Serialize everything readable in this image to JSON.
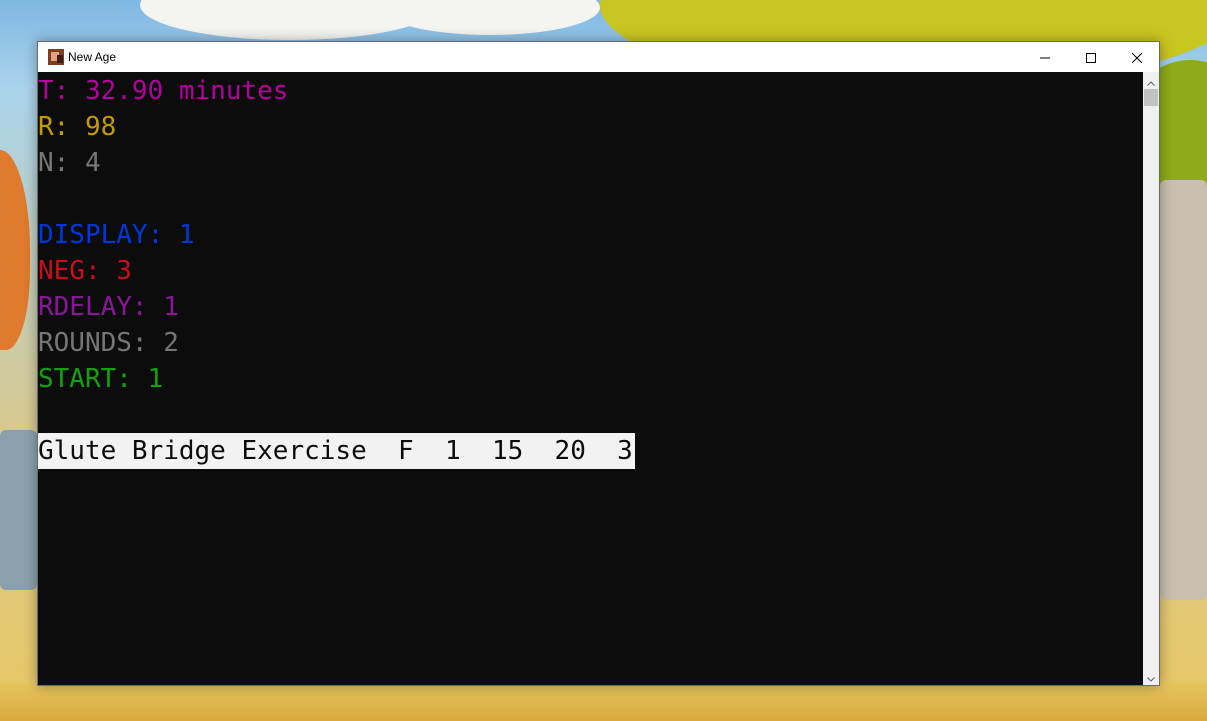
{
  "window": {
    "title": "New Age",
    "controls": {
      "minimize": "minimize",
      "maximize": "maximize",
      "close": "close"
    }
  },
  "console": {
    "background": "#0c0c0c",
    "lines": {
      "t": {
        "text": "T: 32.90 minutes",
        "color": "#b4009e"
      },
      "r": {
        "text": "R: 98",
        "color": "#c19c00"
      },
      "n": {
        "text": "N: 4",
        "color": "#767676"
      },
      "display": {
        "text": "DISPLAY: 1",
        "color": "#0037da"
      },
      "neg": {
        "text": "NEG: 3",
        "color": "#c50f1f"
      },
      "rdelay": {
        "text": "RDELAY: 1",
        "color": "#881798"
      },
      "rounds": {
        "text": "ROUNDS: 2",
        "color": "#767676"
      },
      "start": {
        "text": "START: 1",
        "color": "#13a10e"
      }
    },
    "exercise_row": {
      "text": "Glute Bridge Exercise  F  1  15  20  3"
    }
  },
  "icons": {
    "app": "app-icon",
    "minimize": "minimize-icon",
    "maximize": "maximize-icon",
    "close": "close-icon",
    "scroll_up": "chevron-up-icon",
    "scroll_down": "chevron-down-icon"
  }
}
